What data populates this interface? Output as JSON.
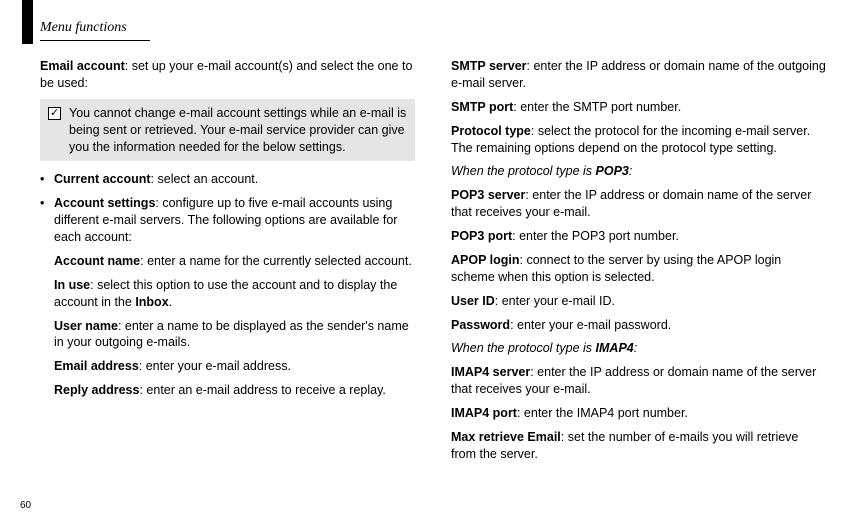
{
  "page_number": "60",
  "header": {
    "title": "Menu functions"
  },
  "left": {
    "email_account_label": "Email account",
    "email_account_text": ": set up your e-mail account(s) and select the one to be used:",
    "note": "You cannot change e-mail account settings while an e-mail is being sent or retrieved. Your e-mail service provider can give you the information needed for the below settings.",
    "current_account_label": "Current account",
    "current_account_text": ": select an account.",
    "account_settings_label": "Account settings",
    "account_settings_text": ": configure up to five e-mail accounts using different e-mail servers. The following options are available for each account:",
    "account_name_label": "Account name",
    "account_name_text": ": enter a name for the currently selected account.",
    "in_use_label": "In use",
    "in_use_text_a": ": select this option to use the account and to display the account in the ",
    "in_use_bold": "Inbox",
    "in_use_text_b": ".",
    "user_name_label": "User name",
    "user_name_text": ": enter a name to be displayed as the sender's name in your outgoing e-mails.",
    "email_address_label": "Email address",
    "email_address_text": ": enter your e-mail address.",
    "reply_address_label": "Reply address",
    "reply_address_text": ": enter an e-mail address to receive a replay."
  },
  "right": {
    "smtp_server_label": "SMTP server",
    "smtp_server_text": ": enter the IP address or domain name of the outgoing e-mail server.",
    "smtp_port_label": "SMTP port",
    "smtp_port_text": ": enter the SMTP port number.",
    "protocol_type_label": "Protocol type",
    "protocol_type_text": ": select the protocol for the incoming e-mail server. The remaining options depend on the protocol type setting.",
    "when_pop3_a": "When the protocol type is ",
    "when_pop3_b": "POP3",
    "when_pop3_c": ":",
    "pop3_server_label": "POP3 server",
    "pop3_server_text": ": enter the IP address or domain name of the server that receives your e-mail.",
    "pop3_port_label": "POP3 port",
    "pop3_port_text": ": enter the POP3 port number.",
    "apop_label": "APOP login",
    "apop_text": ": connect to the server by using the APOP login scheme when this option is selected.",
    "user_id_label": "User ID",
    "user_id_text": ": enter your e-mail ID.",
    "password_label": "Password",
    "password_text": ": enter your e-mail password.",
    "when_imap_a": "When the protocol type is ",
    "when_imap_b": "IMAP4",
    "when_imap_c": ":",
    "imap4_server_label": "IMAP4 server",
    "imap4_server_text": ": enter the IP address or domain name of the server that receives your e-mail.",
    "imap4_port_label": "IMAP4 port",
    "imap4_port_text": ": enter the IMAP4 port number.",
    "max_retrieve_label": "Max retrieve Email",
    "max_retrieve_text": ": set the number of e-mails you will retrieve from the server."
  }
}
